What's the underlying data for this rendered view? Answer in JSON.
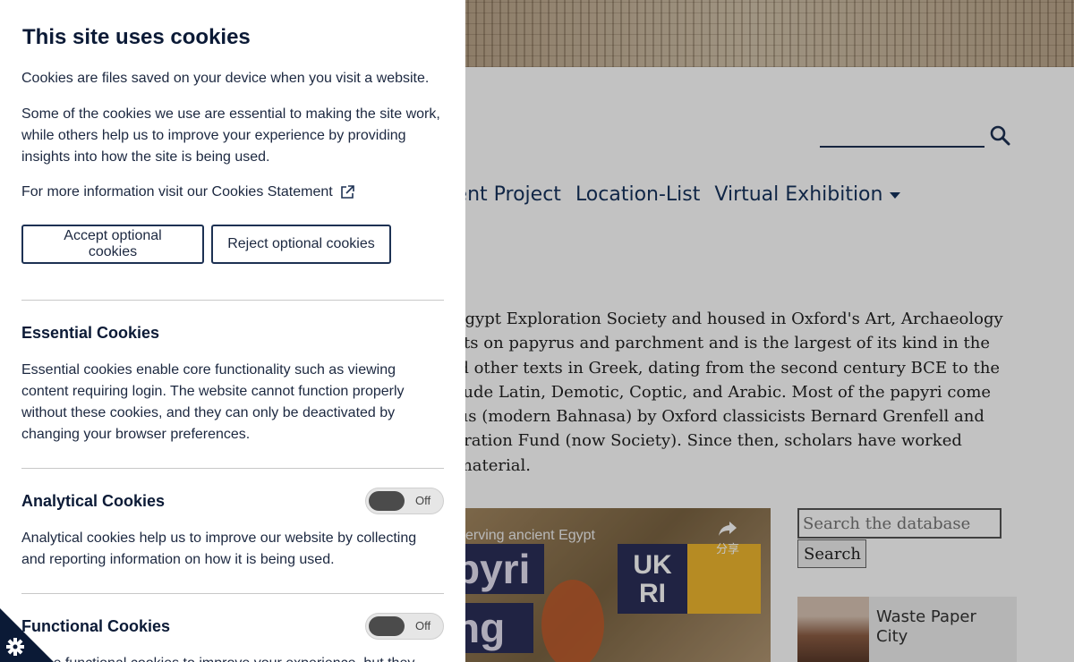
{
  "site": {
    "search_placeholder": "",
    "nav": [
      "rent Project",
      "Location-List",
      "Virtual Exhibition"
    ],
    "intro_lines": [
      "e Egypt Exploration Society and housed in Oxford's Art, Archaeology",
      " texts on papyrus and parchment and is the largest of its kind in the",
      " and other texts in Greek, dating from the second century BCE to the",
      "nclude Latin, Demotic, Coptic, and Arabic. Most of the papyri come",
      "chus (modern Bahnasa) by Oxford classicists Bernard Grenfell and",
      "ploration Fund (now Society). Since then, scholars have worked",
      "is material."
    ],
    "video": {
      "title": "serving ancient Egypt",
      "overlay_top": "pyri",
      "overlay_bottom": "ng",
      "logo_text": "UK\nRI",
      "share_label": "分享"
    },
    "db_search_placeholder": "Search the database",
    "db_search_button": "Search",
    "card_title": "Waste Paper City"
  },
  "cookies": {
    "title": "This site uses cookies",
    "intro": "Cookies are files saved on your device when you visit a website.",
    "essential_note": "Some of the cookies we use are essential to making the site work, while others help us to improve your experience by providing insights into how the site is being used.",
    "more_info": "For more information visit our Cookies Statement",
    "accept_label": "Accept optional cookies",
    "reject_label": "Reject optional cookies",
    "sections": [
      {
        "title": "Essential Cookies",
        "text": "Essential cookies enable core functionality such as viewing content requiring login. The website cannot function properly without these cookies, and they can only be deactivated by changing your browser preferences."
      },
      {
        "title": "Analytical Cookies",
        "text": "Analytical cookies help us to improve our website by collecting and reporting information on how it is being used.",
        "toggle": "Off"
      },
      {
        "title": "Functional Cookies",
        "text": "These functional cookies to improve your experience, but they",
        "toggle": "Off"
      }
    ]
  },
  "colors": {
    "accent": "#1d3153",
    "overlay": "rgba(0,0,0,0.24)"
  }
}
